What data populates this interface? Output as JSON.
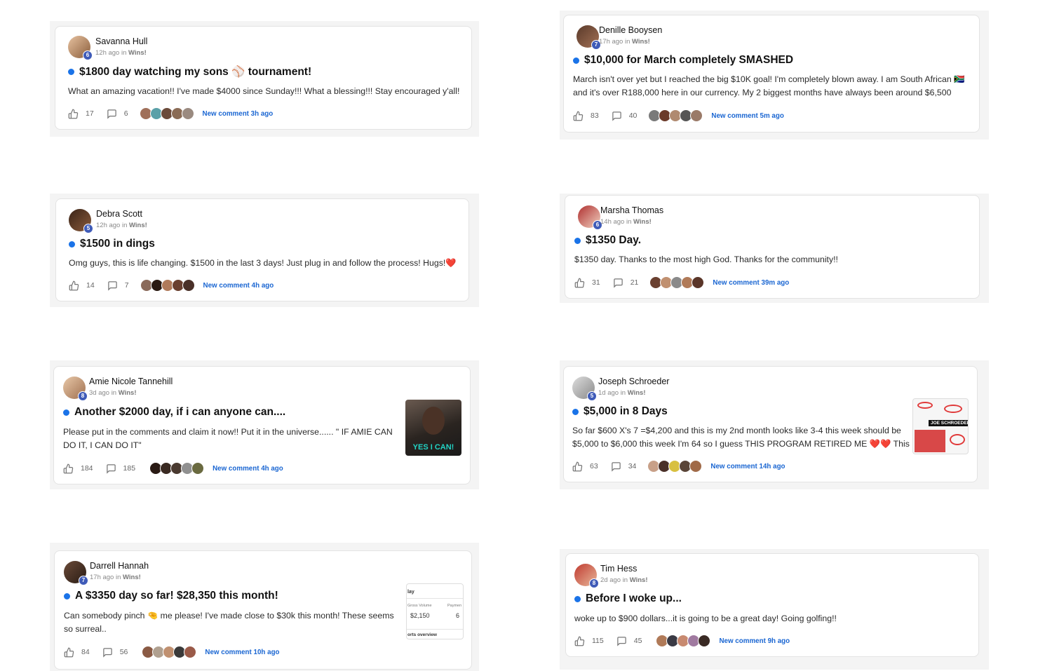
{
  "posts": [
    {
      "author": "Savanna Hull",
      "level": "6",
      "time": "12h ago in",
      "category": "Wins!",
      "title": "$1800 day watching my sons ⚾ tournament!",
      "body": "What an amazing vacation!! I've made $4000 since Sunday!!! What a blessing!!! Stay encouraged y'all!",
      "likes": "17",
      "comments": "6",
      "new_comment": "New comment 3h ago"
    },
    {
      "author": "Denille Booysen",
      "level": "7",
      "time": "17h ago in",
      "category": "Wins!",
      "title": "$10,000 for March completely SMASHED",
      "body": "March isn't over yet but I reached the big $10K goal! I'm completely blown away. I am South African 🇿🇦 and it's over R188,000 here in our currency. My 2 biggest months have always been around $6,500",
      "likes": "83",
      "comments": "40",
      "new_comment": "New comment 5m ago"
    },
    {
      "author": "Debra Scott",
      "level": "5",
      "time": "12h ago in",
      "category": "Wins!",
      "title": "$1500 in dings",
      "body": "Omg guys, this is life changing. $1500 in the last 3 days! Just plug in and follow the process! Hugs!❤️",
      "likes": "14",
      "comments": "7",
      "new_comment": "New comment 4h ago"
    },
    {
      "author": "Marsha Thomas",
      "level": "6",
      "time": "14h ago in",
      "category": "Wins!",
      "title": "$1350 Day.",
      "body": "$1350 day. Thanks to the most high God. Thanks for the community!!",
      "likes": "31",
      "comments": "21",
      "new_comment": "New comment 39m ago"
    },
    {
      "author": "Amie Nicole Tannehill",
      "level": "8",
      "time": "3d ago in",
      "category": "Wins!",
      "title": "Another $2000 day, if i can anyone can....",
      "body": "Please put in the comments and claim it now!! Put it in the universe...... \" IF AMIE CAN DO IT, I CAN DO IT\"",
      "likes": "184",
      "comments": "185",
      "new_comment": "New comment 4h ago",
      "thumb_text": "YES I CAN!"
    },
    {
      "author": "Joseph Schroeder",
      "level": "5",
      "time": "1d ago in",
      "category": "Wins!",
      "title": "$5,000 in 8 Days",
      "body": "So far $600 X's 7 =$4,200 and this is my 2nd month looks like 3-4 this week should be $5,000 to $6,000 this week I'm 64 so I guess THIS PROGRAM RETIRED ME ❤️❤️ This",
      "likes": "63",
      "comments": "34",
      "new_comment": "New comment 14h ago",
      "thumb_text": "JOE SCHROEDER"
    },
    {
      "author": "Darrell Hannah",
      "level": "7",
      "time": "17h ago in",
      "category": "Wins!",
      "title": "A $3350 day so far! $28,350 this month!",
      "body": "Can somebody pinch 🤏 me please! I've made close to $30k this month! These seems so surreal..",
      "likes": "84",
      "comments": "56",
      "new_comment": "New comment 10h ago",
      "thumb": {
        "heading": "lay",
        "col1": "Gross Volume",
        "col2": "Paymen",
        "val1": "$2,150",
        "val2": "6",
        "footer": "orts overview"
      }
    },
    {
      "author": "Tim Hess",
      "level": "8",
      "time": "2d ago in",
      "category": "Wins!",
      "title": "Before I woke up...",
      "body": "woke up to $900 dollars...it is going to be a great day! Going golfing!!",
      "likes": "115",
      "comments": "45",
      "new_comment": "New comment 9h ago"
    }
  ],
  "colors": {
    "accent": "#1a73e8",
    "link": "#1a66d2",
    "level_badge": "#3f5bb8",
    "tile": "#f4f4f4"
  },
  "icons": {
    "like": "thumbs-up-icon",
    "comment": "comment-bubble-icon"
  }
}
